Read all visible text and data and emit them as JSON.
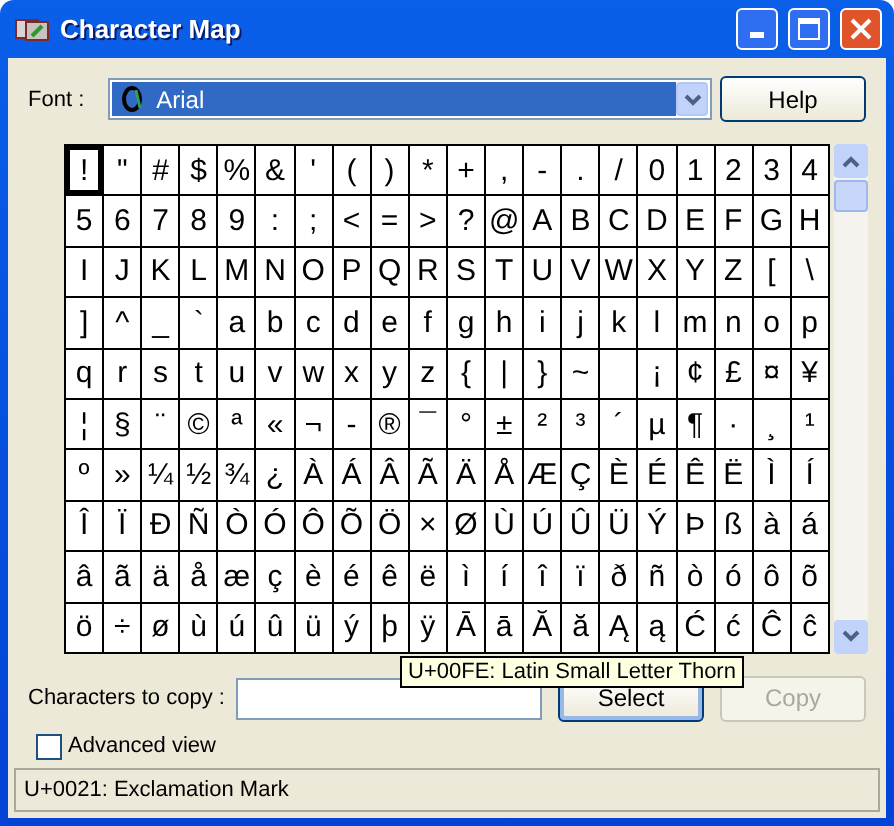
{
  "window": {
    "title": "Character Map"
  },
  "font": {
    "label": "Font :",
    "value": "Arial"
  },
  "help_button": "Help",
  "grid": [
    [
      {
        "c": "!",
        "selected": true
      },
      {
        "c": "\"",
        "selected": false
      },
      {
        "c": "#",
        "selected": false
      },
      {
        "c": "$",
        "selected": false
      },
      {
        "c": "%",
        "selected": false
      },
      {
        "c": "&",
        "selected": false
      },
      {
        "c": "'",
        "selected": false
      },
      {
        "c": "(",
        "selected": false
      },
      {
        "c": ")",
        "selected": false
      },
      {
        "c": "*",
        "selected": false
      },
      {
        "c": "+",
        "selected": false
      },
      {
        "c": ",",
        "selected": false
      },
      {
        "c": "-",
        "selected": false
      },
      {
        "c": ".",
        "selected": false
      },
      {
        "c": "/",
        "selected": false
      },
      {
        "c": "0",
        "selected": false
      },
      {
        "c": "1",
        "selected": false
      },
      {
        "c": "2",
        "selected": false
      },
      {
        "c": "3",
        "selected": false
      },
      {
        "c": "4",
        "selected": false
      }
    ],
    [
      {
        "c": "5",
        "selected": false
      },
      {
        "c": "6",
        "selected": false
      },
      {
        "c": "7",
        "selected": false
      },
      {
        "c": "8",
        "selected": false
      },
      {
        "c": "9",
        "selected": false
      },
      {
        "c": ":",
        "selected": false
      },
      {
        "c": ";",
        "selected": false
      },
      {
        "c": "<",
        "selected": false
      },
      {
        "c": "=",
        "selected": false
      },
      {
        "c": ">",
        "selected": false
      },
      {
        "c": "?",
        "selected": false
      },
      {
        "c": "@",
        "selected": false
      },
      {
        "c": "A",
        "selected": false
      },
      {
        "c": "B",
        "selected": false
      },
      {
        "c": "C",
        "selected": false
      },
      {
        "c": "D",
        "selected": false
      },
      {
        "c": "E",
        "selected": false
      },
      {
        "c": "F",
        "selected": false
      },
      {
        "c": "G",
        "selected": false
      },
      {
        "c": "H",
        "selected": false
      }
    ],
    [
      {
        "c": "I",
        "selected": false
      },
      {
        "c": "J",
        "selected": false
      },
      {
        "c": "K",
        "selected": false
      },
      {
        "c": "L",
        "selected": false
      },
      {
        "c": "M",
        "selected": false
      },
      {
        "c": "N",
        "selected": false
      },
      {
        "c": "O",
        "selected": false
      },
      {
        "c": "P",
        "selected": false
      },
      {
        "c": "Q",
        "selected": false
      },
      {
        "c": "R",
        "selected": false
      },
      {
        "c": "S",
        "selected": false
      },
      {
        "c": "T",
        "selected": false
      },
      {
        "c": "U",
        "selected": false
      },
      {
        "c": "V",
        "selected": false
      },
      {
        "c": "W",
        "selected": false
      },
      {
        "c": "X",
        "selected": false
      },
      {
        "c": "Y",
        "selected": false
      },
      {
        "c": "Z",
        "selected": false
      },
      {
        "c": "[",
        "selected": false
      },
      {
        "c": "\\",
        "selected": false
      }
    ],
    [
      {
        "c": "]",
        "selected": false
      },
      {
        "c": "^",
        "selected": false
      },
      {
        "c": "_",
        "selected": false
      },
      {
        "c": "`",
        "selected": false
      },
      {
        "c": "a",
        "selected": false
      },
      {
        "c": "b",
        "selected": false
      },
      {
        "c": "c",
        "selected": false
      },
      {
        "c": "d",
        "selected": false
      },
      {
        "c": "e",
        "selected": false
      },
      {
        "c": "f",
        "selected": false
      },
      {
        "c": "g",
        "selected": false
      },
      {
        "c": "h",
        "selected": false
      },
      {
        "c": "i",
        "selected": false
      },
      {
        "c": "j",
        "selected": false
      },
      {
        "c": "k",
        "selected": false
      },
      {
        "c": "l",
        "selected": false
      },
      {
        "c": "m",
        "selected": false
      },
      {
        "c": "n",
        "selected": false
      },
      {
        "c": "o",
        "selected": false
      },
      {
        "c": "p",
        "selected": false
      }
    ],
    [
      {
        "c": "q",
        "selected": false
      },
      {
        "c": "r",
        "selected": false
      },
      {
        "c": "s",
        "selected": false
      },
      {
        "c": "t",
        "selected": false
      },
      {
        "c": "u",
        "selected": false
      },
      {
        "c": "v",
        "selected": false
      },
      {
        "c": "w",
        "selected": false
      },
      {
        "c": "x",
        "selected": false
      },
      {
        "c": "y",
        "selected": false
      },
      {
        "c": "z",
        "selected": false
      },
      {
        "c": "{",
        "selected": false
      },
      {
        "c": "|",
        "selected": false
      },
      {
        "c": "}",
        "selected": false
      },
      {
        "c": "~",
        "selected": false
      },
      {
        "selected": false
      },
      {
        "c": "¡",
        "selected": false
      },
      {
        "c": "¢",
        "selected": false
      },
      {
        "c": "£",
        "selected": false
      },
      {
        "c": "¤",
        "selected": false
      },
      {
        "c": "¥",
        "selected": false
      }
    ],
    [
      {
        "c": "¦",
        "selected": false
      },
      {
        "c": "§",
        "selected": false
      },
      {
        "c": "¨",
        "selected": false
      },
      {
        "c": "©",
        "selected": false
      },
      {
        "c": "ª",
        "selected": false
      },
      {
        "c": "«",
        "selected": false
      },
      {
        "c": "¬",
        "selected": false
      },
      {
        "c": "-",
        "selected": false
      },
      {
        "c": "®",
        "selected": false
      },
      {
        "c": "¯",
        "selected": false
      },
      {
        "c": "°",
        "selected": false
      },
      {
        "c": "±",
        "selected": false
      },
      {
        "c": "²",
        "selected": false
      },
      {
        "c": "³",
        "selected": false
      },
      {
        "c": "´",
        "selected": false
      },
      {
        "c": "µ",
        "selected": false
      },
      {
        "c": "¶",
        "selected": false
      },
      {
        "c": "·",
        "selected": false
      },
      {
        "c": "¸",
        "selected": false
      },
      {
        "c": "¹",
        "selected": false
      }
    ],
    [
      {
        "c": "º",
        "selected": false
      },
      {
        "c": "»",
        "selected": false
      },
      {
        "c": "¼",
        "selected": false
      },
      {
        "c": "½",
        "selected": false
      },
      {
        "c": "¾",
        "selected": false
      },
      {
        "c": "¿",
        "selected": false
      },
      {
        "c": "À",
        "selected": false
      },
      {
        "c": "Á",
        "selected": false
      },
      {
        "c": "Â",
        "selected": false
      },
      {
        "c": "Ã",
        "selected": false
      },
      {
        "c": "Ä",
        "selected": false
      },
      {
        "c": "Å",
        "selected": false
      },
      {
        "c": "Æ",
        "selected": false
      },
      {
        "c": "Ç",
        "selected": false
      },
      {
        "c": "È",
        "selected": false
      },
      {
        "c": "É",
        "selected": false
      },
      {
        "c": "Ê",
        "selected": false
      },
      {
        "c": "Ë",
        "selected": false
      },
      {
        "c": "Ì",
        "selected": false
      },
      {
        "c": "Í",
        "selected": false
      }
    ],
    [
      {
        "c": "Î",
        "selected": false
      },
      {
        "c": "Ï",
        "selected": false
      },
      {
        "c": "Ð",
        "selected": false
      },
      {
        "c": "Ñ",
        "selected": false
      },
      {
        "c": "Ò",
        "selected": false
      },
      {
        "c": "Ó",
        "selected": false
      },
      {
        "c": "Ô",
        "selected": false
      },
      {
        "c": "Õ",
        "selected": false
      },
      {
        "c": "Ö",
        "selected": false
      },
      {
        "c": "×",
        "selected": false
      },
      {
        "c": "Ø",
        "selected": false
      },
      {
        "c": "Ù",
        "selected": false
      },
      {
        "c": "Ú",
        "selected": false
      },
      {
        "c": "Û",
        "selected": false
      },
      {
        "c": "Ü",
        "selected": false
      },
      {
        "c": "Ý",
        "selected": false
      },
      {
        "c": "Þ",
        "selected": false
      },
      {
        "c": "ß",
        "selected": false
      },
      {
        "c": "à",
        "selected": false
      },
      {
        "c": "á",
        "selected": false
      }
    ],
    [
      {
        "c": "â",
        "selected": false
      },
      {
        "c": "ã",
        "selected": false
      },
      {
        "c": "ä",
        "selected": false
      },
      {
        "c": "å",
        "selected": false
      },
      {
        "c": "æ",
        "selected": false
      },
      {
        "c": "ç",
        "selected": false
      },
      {
        "c": "è",
        "selected": false
      },
      {
        "c": "é",
        "selected": false
      },
      {
        "c": "ê",
        "selected": false
      },
      {
        "c": "ë",
        "selected": false
      },
      {
        "c": "ì",
        "selected": false
      },
      {
        "c": "í",
        "selected": false
      },
      {
        "c": "î",
        "selected": false
      },
      {
        "c": "ï",
        "selected": false
      },
      {
        "c": "ð",
        "selected": false
      },
      {
        "c": "ñ",
        "selected": false
      },
      {
        "c": "ò",
        "selected": false
      },
      {
        "c": "ó",
        "selected": false
      },
      {
        "c": "ô",
        "selected": false
      },
      {
        "c": "õ",
        "selected": false
      }
    ],
    [
      {
        "c": "ö",
        "selected": false
      },
      {
        "c": "÷",
        "selected": false
      },
      {
        "c": "ø",
        "selected": false
      },
      {
        "c": "ù",
        "selected": false
      },
      {
        "c": "ú",
        "selected": false
      },
      {
        "c": "û",
        "selected": false
      },
      {
        "c": "ü",
        "selected": false
      },
      {
        "c": "ý",
        "selected": false
      },
      {
        "c": "þ",
        "selected": false
      },
      {
        "c": "ÿ",
        "selected": false
      },
      {
        "c": "Ā",
        "selected": false
      },
      {
        "c": "ā",
        "selected": false
      },
      {
        "c": "Ă",
        "selected": false
      },
      {
        "c": "ă",
        "selected": false
      },
      {
        "c": "Ą",
        "selected": false
      },
      {
        "c": "ą",
        "selected": false
      },
      {
        "c": "Ć",
        "selected": false
      },
      {
        "c": "ć",
        "selected": false
      },
      {
        "c": "Ĉ",
        "selected": false
      },
      {
        "c": "ĉ",
        "selected": false
      }
    ]
  ],
  "tooltip": "U+00FE: Latin Small Letter Thorn",
  "copy_field": {
    "label": "Characters to copy :"
  },
  "select_button": "Select",
  "copy_button": {
    "label": "Copy",
    "disabled": true
  },
  "advanced_view": {
    "label": "Advanced view",
    "checked": false
  },
  "status_bar": "U+0021: Exclamation Mark"
}
